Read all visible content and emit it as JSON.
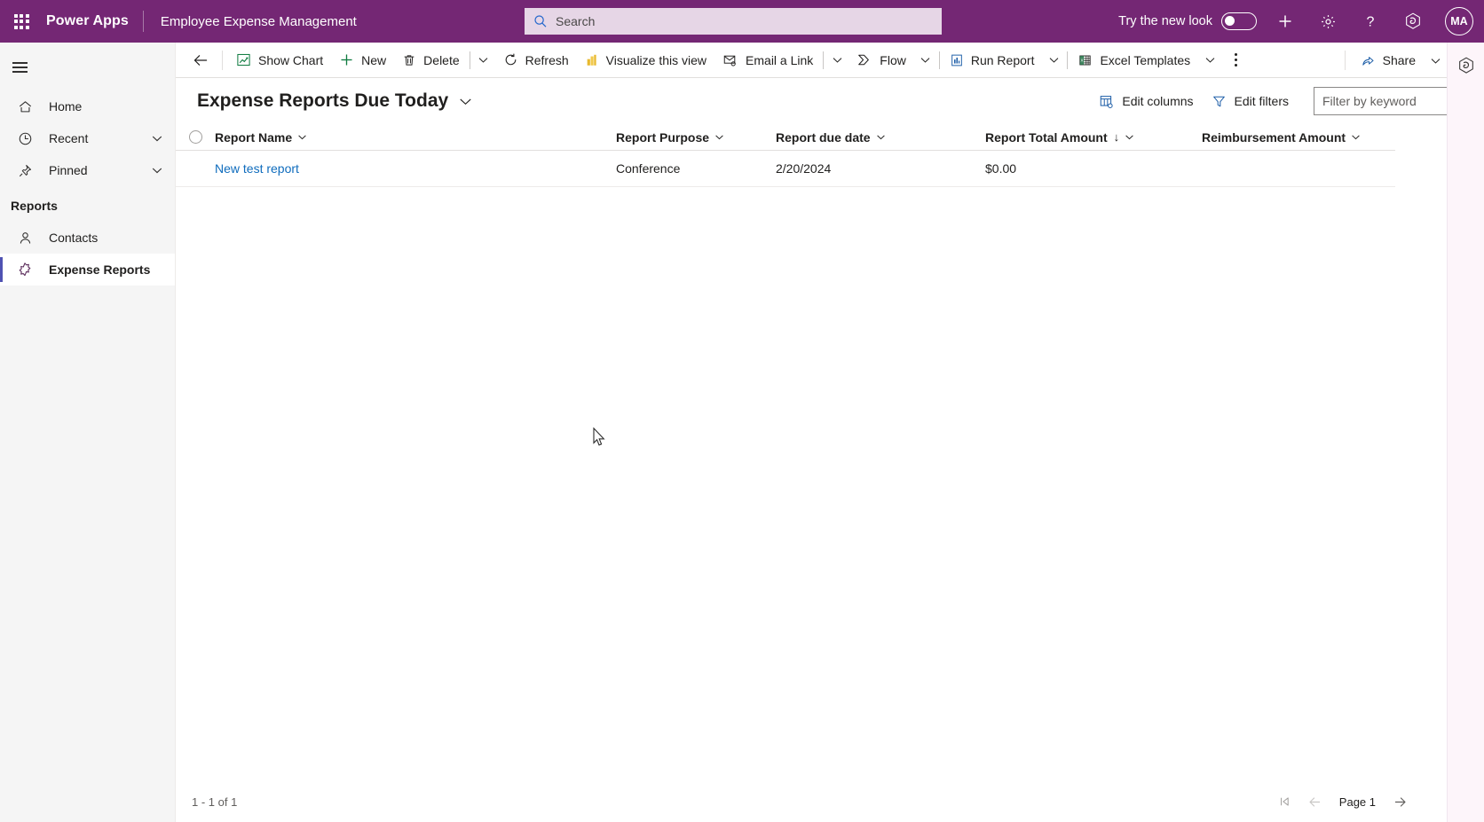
{
  "header": {
    "waffle_icon": "app-launcher-icon",
    "brand": "Power Apps",
    "app_name": "Employee Expense Management",
    "search": {
      "placeholder": "Search",
      "value": "",
      "icon": "search-icon"
    },
    "new_look": {
      "label": "Try the new look",
      "state": "off"
    },
    "icons": [
      "plus-icon",
      "gear-icon",
      "question-mark-icon",
      "copilot-icon"
    ],
    "avatar": {
      "initials": "MA"
    },
    "accent_color": "#742774",
    "search_bg": "#e6d6e6"
  },
  "sidebar": {
    "hamburger_icon": "hamburger-menu-icon",
    "items": [
      {
        "label": "Home",
        "icon": "home-icon",
        "expandable": false,
        "selected": false
      },
      {
        "label": "Recent",
        "icon": "clock-icon",
        "expandable": true,
        "selected": false
      },
      {
        "label": "Pinned",
        "icon": "pin-icon",
        "expandable": true,
        "selected": false
      }
    ],
    "group_header": "Reports",
    "group_items": [
      {
        "label": "Contacts",
        "icon": "person-icon",
        "selected": false
      },
      {
        "label": "Expense Reports",
        "icon": "entity-icon",
        "selected": true
      }
    ],
    "selected_indicator_color": "#4f52b2",
    "background": "#f5f5f5"
  },
  "command_bar": {
    "back_icon": "back-arrow-icon",
    "buttons": [
      {
        "label": "Show Chart",
        "icon": "show-chart-icon",
        "caret": false
      },
      {
        "label": "New",
        "icon": "plus-icon",
        "caret": false
      },
      {
        "label": "Delete",
        "icon": "trash-icon",
        "caret": true
      },
      {
        "label": "Refresh",
        "icon": "refresh-icon",
        "caret": false
      },
      {
        "label": "Visualize this view",
        "icon": "power-bi-icon",
        "caret": false
      },
      {
        "label": "Email a Link",
        "icon": "email-link-icon",
        "caret": true
      },
      {
        "label": "Flow",
        "icon": "flow-icon",
        "caret": true
      },
      {
        "label": "Run Report",
        "icon": "report-icon",
        "caret": true
      },
      {
        "label": "Excel Templates",
        "icon": "excel-icon",
        "caret": true
      }
    ],
    "overflow_icon": "more-options-icon",
    "share": {
      "label": "Share",
      "icon": "share-icon",
      "caret": true
    }
  },
  "view": {
    "title": "Expense Reports Due Today",
    "title_chevron": "chevron-down-icon",
    "edit_columns": {
      "label": "Edit columns",
      "icon": "edit-columns-icon"
    },
    "edit_filters": {
      "label": "Edit filters",
      "icon": "filter-icon"
    },
    "keyword_filter": {
      "placeholder": "Filter by keyword",
      "value": ""
    }
  },
  "grid": {
    "select_all_icon": "select-all-circle-icon",
    "columns": [
      {
        "header": "Report Name",
        "sorted": false
      },
      {
        "header": "Report Purpose",
        "sorted": false
      },
      {
        "header": "Report due date",
        "sorted": false
      },
      {
        "header": "Report Total Amount",
        "sorted": true,
        "sort_direction": "desc",
        "sort_glyph": "↓"
      },
      {
        "header": "Reimbursement Amount",
        "sorted": false
      }
    ],
    "rows": [
      {
        "report_name": "New test report",
        "report_purpose": "Conference",
        "report_due_date": "2/20/2024",
        "report_total_amount": "$0.00",
        "reimbursement_amount": ""
      }
    ],
    "link_color": "#0f6cbd"
  },
  "footer": {
    "record_count": "1 - 1 of 1",
    "first_page_icon": "first-page-icon",
    "prev_page_icon": "previous-page-icon",
    "page_label": "Page 1",
    "next_page_icon": "next-page-icon"
  },
  "rail": {
    "copilot_icon": "copilot-icon"
  }
}
